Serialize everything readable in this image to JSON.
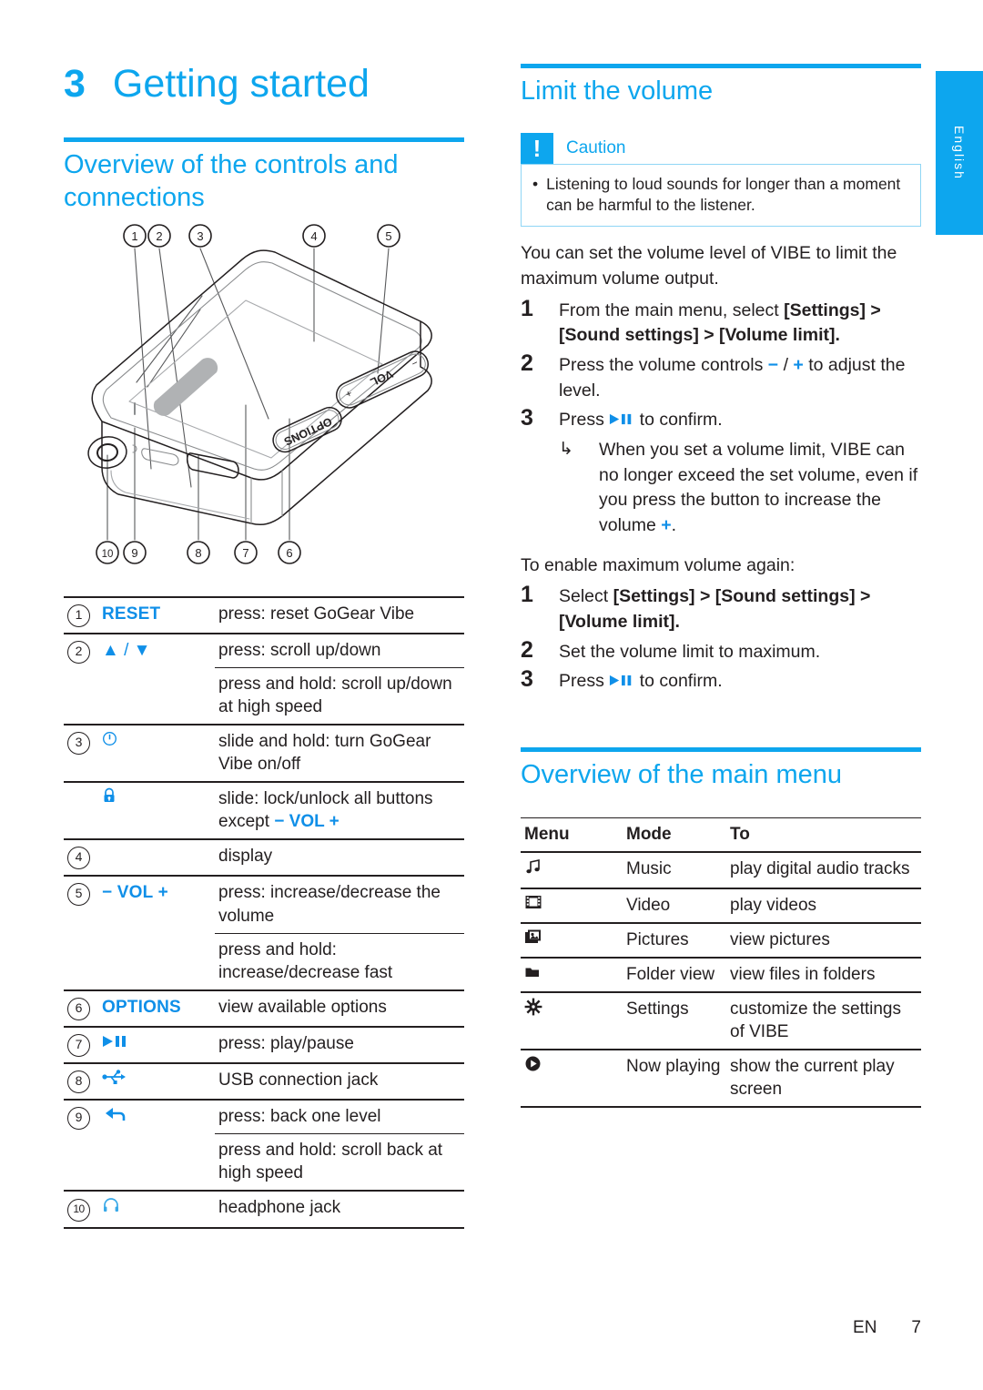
{
  "language_tab": {
    "label": "English"
  },
  "chapter": {
    "number": "3",
    "title": "Getting started"
  },
  "left": {
    "section_title": "Overview of the controls and connections",
    "figure": {
      "name": "gogear-vibe-device-diagram",
      "callouts_top": [
        "1",
        "2",
        "3",
        "4",
        "5"
      ],
      "callouts_bottom": [
        "10",
        "9",
        "8",
        "7",
        "6"
      ],
      "device_labels": [
        "VOL",
        "OPTIONS",
        "−",
        "+"
      ]
    },
    "controls_table": {
      "rows": [
        {
          "num": "1",
          "key": "RESET",
          "key_type": "text",
          "desc": [
            "press: reset GoGear Vibe"
          ]
        },
        {
          "num": "2",
          "key": "▲ / ▼",
          "key_type": "icon",
          "desc": [
            "press: scroll up/down",
            "press and hold: scroll up/down at high speed"
          ]
        },
        {
          "num": "3",
          "key": "power-icon",
          "key_type": "icon",
          "desc": [
            "slide and hold: turn GoGear Vibe on/off"
          ]
        },
        {
          "num": "",
          "key": "lock-icon",
          "key_type": "icon",
          "desc_pre": "slide: lock/unlock all buttons except ",
          "desc_post": "− VOL +"
        },
        {
          "num": "4",
          "key": "",
          "key_type": "none",
          "desc": [
            "display"
          ]
        },
        {
          "num": "5",
          "key": "− VOL +",
          "key_type": "text",
          "desc": [
            "press: increase/decrease the volume",
            "press and hold: increase/decrease fast"
          ]
        },
        {
          "num": "6",
          "key": "OPTIONS",
          "key_type": "text",
          "desc": [
            "view available options"
          ]
        },
        {
          "num": "7",
          "key": "play-pause-icon",
          "key_type": "icon",
          "desc": [
            "press: play/pause"
          ]
        },
        {
          "num": "8",
          "key": "usb-icon",
          "key_type": "icon",
          "desc": [
            "USB connection jack"
          ]
        },
        {
          "num": "9",
          "key": "back-arrow-icon",
          "key_type": "icon",
          "desc": [
            "press: back one level",
            "press and hold: scroll back at high speed"
          ]
        },
        {
          "num": "10",
          "key": "headphone-icon",
          "key_type": "icon",
          "desc": [
            "headphone jack"
          ]
        }
      ]
    }
  },
  "right": {
    "section_title": "Limit the volume",
    "caution": {
      "label": "Caution",
      "badge": "!",
      "bullet": "•",
      "text": "Listening to loud sounds for longer than a moment can be harmful to the listener."
    },
    "intro": "You can set the volume level of VIBE to limit the maximum volume output.",
    "steps_limit": [
      {
        "num": "1",
        "text_pre": "From the main menu, select ",
        "bold": "[Settings] > [Sound settings] > [Volume limit].",
        "text_post": ""
      },
      {
        "num": "2",
        "text_pre": "Press the volume controls ",
        "icon_minus": "−",
        "sep": " / ",
        "icon_plus": "+",
        "text_post": " to adjust the level."
      },
      {
        "num": "3",
        "text_pre": "Press ",
        "icon": "play-pause-icon",
        "text_post": " to confirm."
      }
    ],
    "substep": {
      "arrow": "↳",
      "text_pre": "When you set a volume limit, VIBE can no longer exceed the set volume, even if you press the button to increase the volume ",
      "icon_plus": "+",
      "text_post": "."
    },
    "enable_again_intro": "To enable maximum volume again:",
    "steps_enable": [
      {
        "num": "1",
        "text_pre": "Select ",
        "bold": "[Settings] > [Sound settings] > [Volume limit].",
        "text_post": ""
      },
      {
        "num": "2",
        "text_pre": "Set the volume limit to maximum.",
        "text_post": ""
      },
      {
        "num": "3",
        "text_pre": "Press ",
        "icon": "play-pause-icon",
        "text_post": " to confirm."
      }
    ],
    "main_menu_title": "Overview of the main menu",
    "menu_table": {
      "headers": [
        "Menu",
        "Mode",
        "To"
      ],
      "rows": [
        {
          "icon": "music-note-icon",
          "glyph": "♫",
          "mode": "Music",
          "to": "play digital audio tracks"
        },
        {
          "icon": "video-film-icon",
          "glyph": "▣",
          "mode": "Video",
          "to": "play videos"
        },
        {
          "icon": "pictures-icon",
          "glyph": "ὛC",
          "mode": "Pictures",
          "to": "view pictures"
        },
        {
          "icon": "folder-icon",
          "glyph": "▰",
          "mode": "Folder view",
          "to": "view files in folders"
        },
        {
          "icon": "settings-gear-icon",
          "glyph": "⚙",
          "mode": "Settings",
          "to": "customize the settings of VIBE"
        },
        {
          "icon": "now-playing-icon",
          "glyph": "◉",
          "mode": "Now playing",
          "to": "show the current play screen"
        }
      ]
    }
  },
  "footer": {
    "lang_code": "EN",
    "page_number": "7"
  },
  "colors": {
    "brand_blue": "#0DA6EE",
    "icon_blue": "#0F8FE8",
    "text": "#231f20",
    "caution_border": "#8fd6f5"
  }
}
